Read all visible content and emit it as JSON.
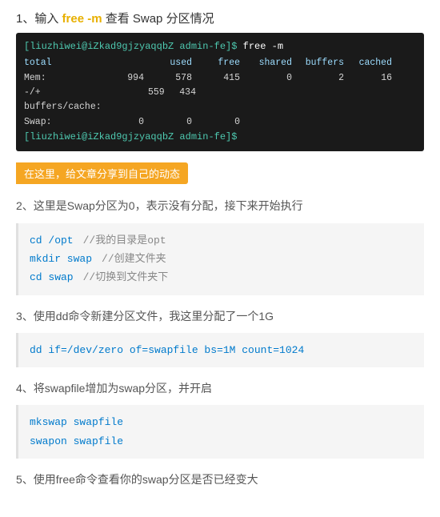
{
  "page": {
    "section1": {
      "title_prefix": "1、输入 ",
      "title_cmd": "free -m",
      "title_suffix": " 查看 Swap 分区情况",
      "terminal": {
        "prompt_line": "[liuzhiwei@iZkad9gjzyaqqbZ admin-fe]$ free -m",
        "header": "              total        used        free      shared     buffers      cached",
        "mem_label": "Mem:",
        "mem_values": [
          "994",
          "578",
          "415",
          "0",
          "2",
          "16"
        ],
        "bufcache_label": "-/+ buffers/cache:",
        "bufcache_values": [
          "559",
          "434"
        ],
        "swap_label": "Swap:",
        "swap_values": [
          "0",
          "0",
          "0"
        ],
        "end_prompt": "[liuzhiwei@iZkad9gjzyaqqbZ admin-fe]$"
      }
    },
    "banner": {
      "text": "在这里，给文章分享到自己的动态"
    },
    "section2": {
      "text": "2、这里是Swap分区为0，表示没有分配，接下来开始执行",
      "code": [
        {
          "cmd": "cd /opt",
          "comment": "//我的目录是opt"
        },
        {
          "cmd": "mkdir swap",
          "comment": "//创建文件夹"
        },
        {
          "cmd": "cd swap",
          "comment": "//切换到文件夹下"
        }
      ]
    },
    "section3": {
      "title": "3、使用dd命令新建分区文件，我这里分配了一个1G",
      "code": [
        {
          "cmd": "dd if=/dev/zero of=swapfile bs=1M count=1024",
          "comment": ""
        }
      ]
    },
    "section4": {
      "title": "4、将swapfile增加为swap分区，并开启",
      "code": [
        {
          "cmd": "mkswap swapfile",
          "comment": ""
        },
        {
          "cmd": "swapon swapfile",
          "comment": ""
        }
      ]
    },
    "section5": {
      "title": "5、使用free命令查看你的swap分区是否已经变大"
    }
  }
}
